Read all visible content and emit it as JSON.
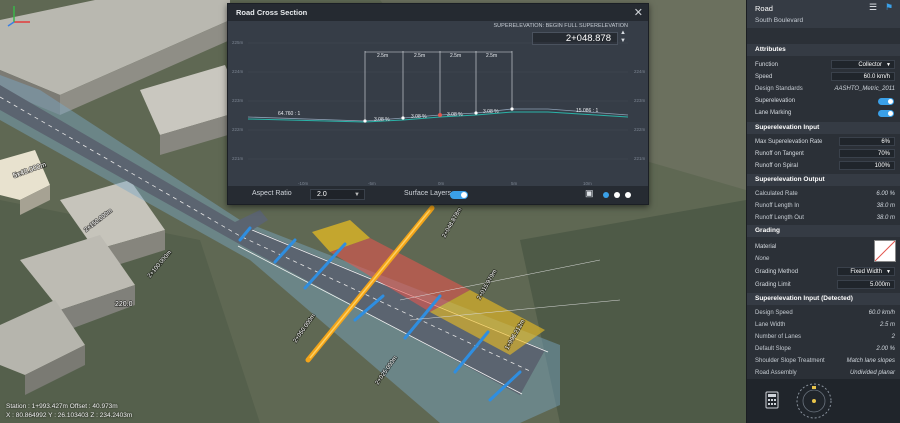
{
  "viewport": {
    "status_line1": "Station : 1+993.427m  Offset : 40.973m",
    "status_line2": "X : 80.864992  Y : 26.103403  Z : 234.2403m",
    "building_labels": [
      "5x48.000m",
      "220.0"
    ],
    "road_labels": [
      "2+150.000m",
      "2+100.000m",
      "2+050.000m",
      "2+025.000m",
      "2+000.000m",
      "1+996.212m",
      "2+046.212m",
      "2+037.875m",
      "2+048.878m",
      "2+015.979m",
      "2+024.402m",
      "2+062.000m"
    ]
  },
  "cross_section": {
    "title": "Road Cross Section",
    "superelevation_status": "SUPERELEVATION: BEGIN FULL SUPERELEVATION",
    "station": "2+048.878",
    "y_ticks_left": [
      "225m",
      "224m",
      "223m",
      "222m",
      "221m",
      "220m"
    ],
    "y_ticks_right": [
      "225m",
      "224m",
      "223m",
      "222m",
      "221m",
      "220m"
    ],
    "x_ticks": [
      "-10m",
      "-5m",
      "0m",
      "5m",
      "10m"
    ],
    "lane_widths": [
      "2.5m",
      "2.5m",
      "2.5m",
      "2.5m"
    ],
    "slope_labels": [
      "64.760 : 1",
      "3.08 %",
      "3.08 %",
      "3.08 %",
      "3.08 %",
      "15.086 : 1"
    ],
    "aspect_ratio_label": "Aspect Ratio",
    "aspect_ratio_value": "2.0",
    "surface_layers_label": "Surface Layers"
  },
  "panel": {
    "title": "Road",
    "subtitle": "South Boulevard",
    "attributes": {
      "header": "Attributes",
      "function_label": "Function",
      "function_value": "Collector",
      "speed_label": "Speed",
      "speed_value": "60.0",
      "speed_unit": "km/h",
      "design_standards_label": "Design Standards",
      "design_standards_value": "AASHTO_Metric_2011",
      "superelevation_label": "Superelevation",
      "lane_marking_label": "Lane Marking"
    },
    "se_input": {
      "header": "Superelevation Input",
      "max_rate_label": "Max Superelevation Rate",
      "max_rate_value": "6%",
      "runoff_tangent_label": "Runoff on Tangent",
      "runoff_tangent_value": "70%",
      "runoff_spiral_label": "Runoff on Spiral",
      "runoff_spiral_value": "100%"
    },
    "se_output": {
      "header": "Superelevation Output",
      "calc_rate_label": "Calculated Rate",
      "calc_rate_value": "6.00 %",
      "runoff_in_label": "Runoff Length In",
      "runoff_in_value": "38.0 m",
      "runoff_out_label": "Runoff Length Out",
      "runoff_out_value": "38.0 m"
    },
    "grading": {
      "header": "Grading",
      "material_label": "Material",
      "material_value": "None",
      "method_label": "Grading Method",
      "method_value": "Fixed Width",
      "limit_label": "Grading Limit",
      "limit_value": "5.000m"
    },
    "se_detected": {
      "header": "Superelevation Input (Detected)",
      "design_speed_label": "Design Speed",
      "design_speed_value": "60.0 km/h",
      "lane_width_label": "Lane Width",
      "lane_width_value": "2.5 m",
      "lanes_label": "Number of Lanes",
      "lanes_value": "2",
      "default_slope_label": "Default Slope",
      "default_slope_value": "2.00 %",
      "shoulder_label": "Shoulder Slope Treatment",
      "shoulder_value": "Match lane slopes",
      "assembly_label": "Road Assembly",
      "assembly_value": "Undivided planar"
    }
  },
  "colors": {
    "accent": "#3aa0e8",
    "highlight_red": "#e2564f",
    "highlight_yellow": "#f0c020"
  }
}
